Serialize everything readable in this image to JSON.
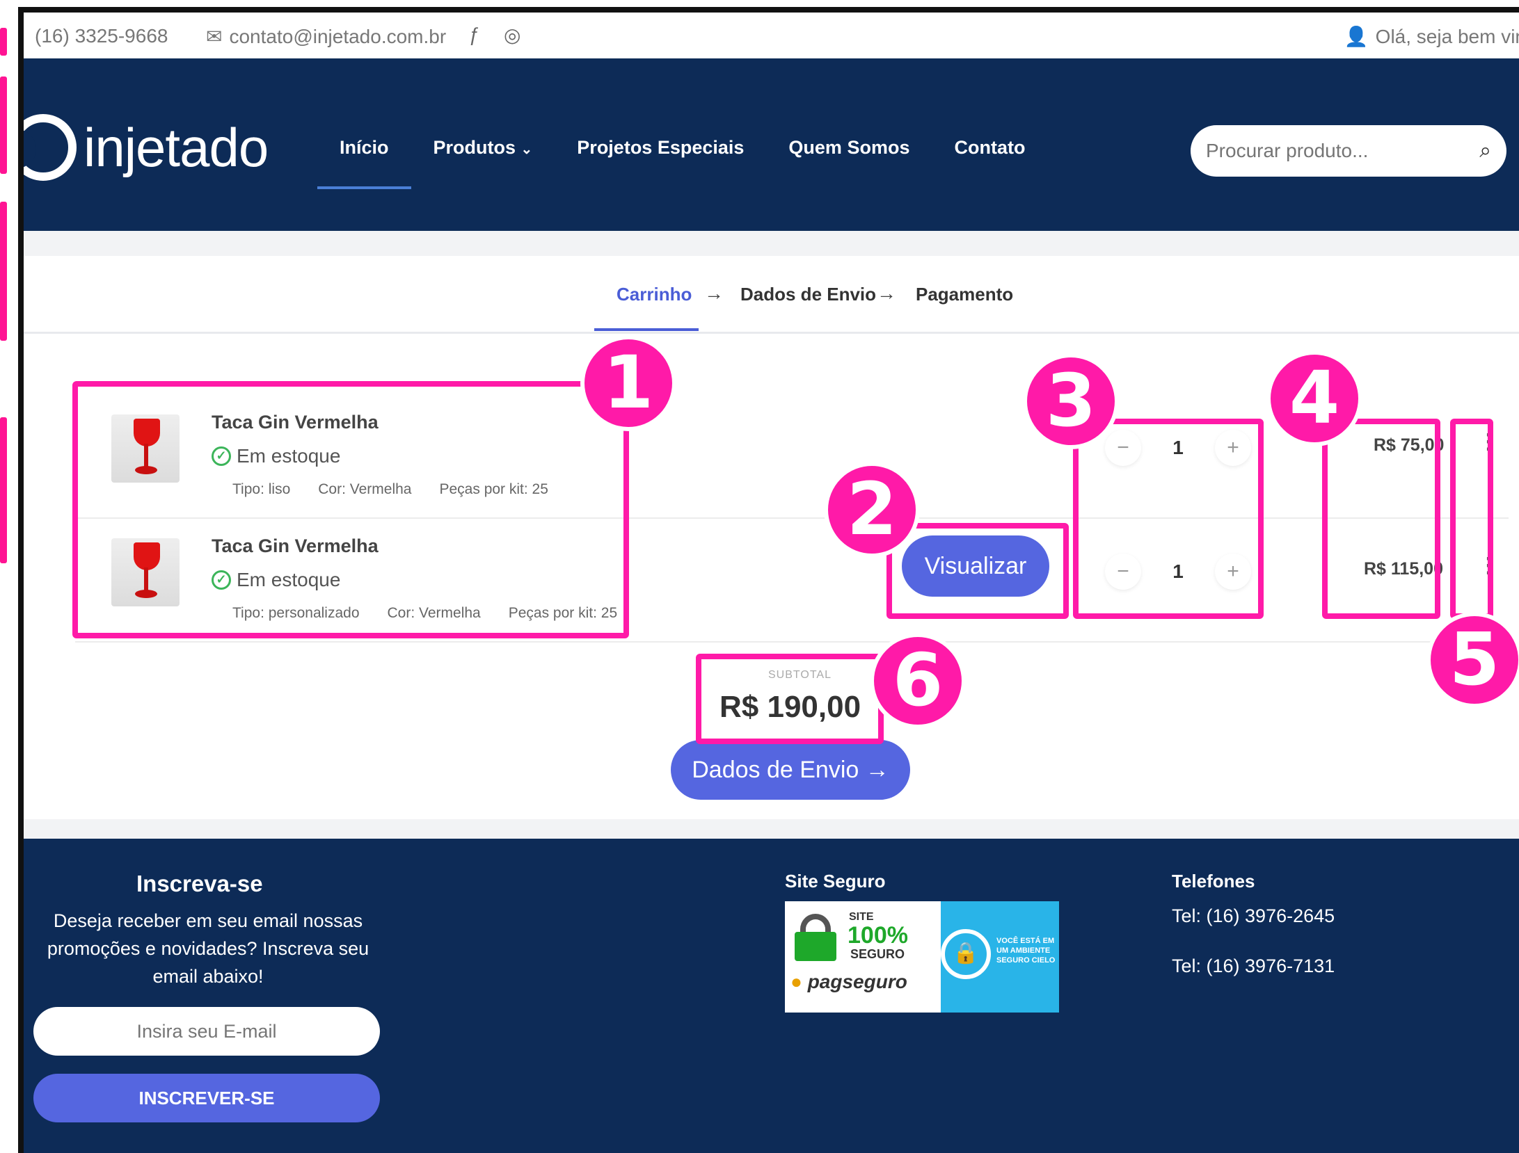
{
  "topbar": {
    "phone": "(16) 3325-9668",
    "email": "contato@injetado.com.br",
    "welcome": "Olá, seja bem vin"
  },
  "header": {
    "logo_text": "injetado",
    "nav": [
      "Início",
      "Produtos",
      "Projetos Especiais",
      "Quem Somos",
      "Contato"
    ],
    "search_placeholder": "Procurar produto..."
  },
  "steps": {
    "cart": "Carrinho",
    "shipping": "Dados de Envio",
    "payment": "Pagamento"
  },
  "cart": {
    "items": [
      {
        "name": "Taca Gin Vermelha",
        "stock": "Em estoque",
        "tipo": "Tipo: liso",
        "cor": "Cor: Vermelha",
        "pecas": "Peças por kit: 25",
        "qty": "1",
        "price": "R$ 75,00"
      },
      {
        "name": "Taca Gin Vermelha",
        "stock": "Em estoque",
        "tipo": "Tipo: personalizado",
        "cor": "Cor: Vermelha",
        "pecas": "Peças por kit: 25",
        "qty": "1",
        "price": "R$ 115,00"
      }
    ],
    "visualizar": "Visualizar",
    "qty_minus": "−",
    "qty_plus": "+",
    "menu": "⋮",
    "subtotal_label": "SUBTOTAL",
    "subtotal": "R$ 190,00",
    "next_button": "Dados de Envio →"
  },
  "footer": {
    "subscribe_title": "Inscreva-se",
    "subscribe_text_1": "Deseja receber em seu email nossas",
    "subscribe_text_2": "promoções e novidades? Inscreva seu",
    "subscribe_text_3": "email abaixo!",
    "email_placeholder": "Insira seu E-mail",
    "subscribe_button": "INSCREVER-SE",
    "secure_title": "Site Seguro",
    "seal_site": "SITE",
    "seal_100": "100%",
    "seal_seguro": "SEGURO",
    "seal_pag": "pagseguro",
    "seal_note": "VOCÊ ESTÁ EM UM AMBIENTE SEGURO CIELO",
    "phones_title": "Telefones",
    "tel_1": "Tel: (16) 3976-2645",
    "tel_2": "Tel: (16) 3976-7131"
  },
  "annotations": [
    "1",
    "2",
    "3",
    "4",
    "5",
    "6"
  ],
  "colors": {
    "navy": "#0d2b57",
    "accent": "#5566e0",
    "annotation": "#ff1aa8"
  }
}
